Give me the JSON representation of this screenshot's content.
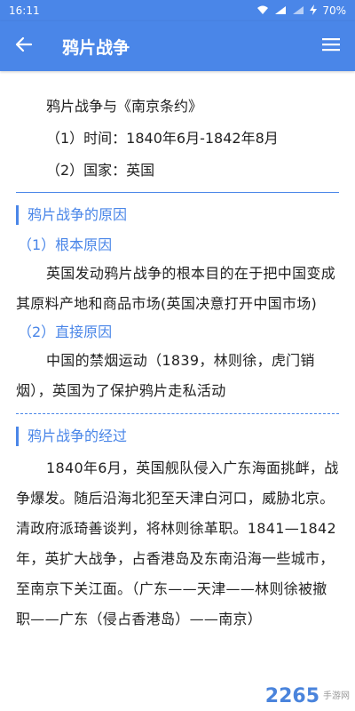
{
  "status_bar": {
    "time": "16:11",
    "battery": "70%"
  },
  "app_bar": {
    "title": "鸦片战争"
  },
  "intro": {
    "line1": "鸦片战争与《南京条约》",
    "line2": "（1）时间：1840年6月-1842年8月",
    "line3": "（2）国家：英国"
  },
  "sections": [
    {
      "title": "鸦片战争的原因",
      "sub1": "（1）根本原因",
      "para1": "英国发动鸦片战争的根本目的在于把中国变成其原料产地和商品市场(英国决意打开中国市场)",
      "sub2": "（2）直接原因",
      "para2": "中国的禁烟运动（1839，林则徐，虎门销烟），英国为了保护鸦片走私活动"
    },
    {
      "title": "鸦片战争的经过",
      "para1": "1840年6月，英国舰队侵入广东海面挑衅，战争爆发。随后沿海北犯至天津白河口，威胁北京。清政府派琦善谈判，将林则徐革职。1841—1842年，英扩大战争，占香港岛及东南沿海一些城市，至南京下关江面。（广东——天津——林则徐被撤职——广东（侵占香港岛）——南京）"
    }
  ],
  "watermark": {
    "logo": "2265",
    "text": "手游网"
  },
  "colors": {
    "accent": "#4a86e8"
  }
}
